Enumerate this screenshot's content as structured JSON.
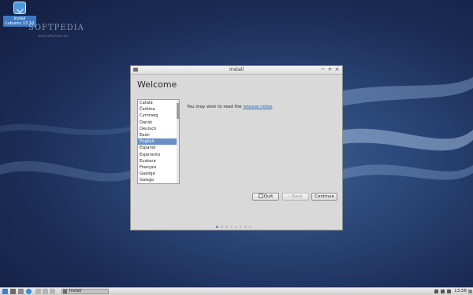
{
  "desktop": {
    "icon": {
      "name": "install-icon",
      "label_line1": "Install",
      "label_line2": "Lubuntu 13.10"
    },
    "watermark": "SOFTPEDIA",
    "watermark_sub": "www.softpedia.com"
  },
  "window": {
    "title": "Install",
    "controls": {
      "minimize": "−",
      "maximize": "+",
      "close": "×"
    },
    "heading": "Welcome",
    "languages": [
      "Català",
      "Čeština",
      "Cymraeg",
      "Dansk",
      "Deutsch",
      "Eesti",
      "English",
      "Español",
      "Esperanto",
      "Euskara",
      "Français",
      "Gaeilge",
      "Galego"
    ],
    "selected_language": "English",
    "release_text": "You may wish to read the",
    "release_link": "release notes",
    "release_tail": ".",
    "buttons": {
      "quit": "Quit",
      "back": "Back",
      "continue": "Continue"
    },
    "steps": {
      "total": 8,
      "current": 1
    }
  },
  "panel": {
    "task_label": "Install",
    "clock": "13:58"
  },
  "colors": {
    "accent": "#6890c4",
    "link": "#2f68b5",
    "desktop": "#2a4476"
  }
}
